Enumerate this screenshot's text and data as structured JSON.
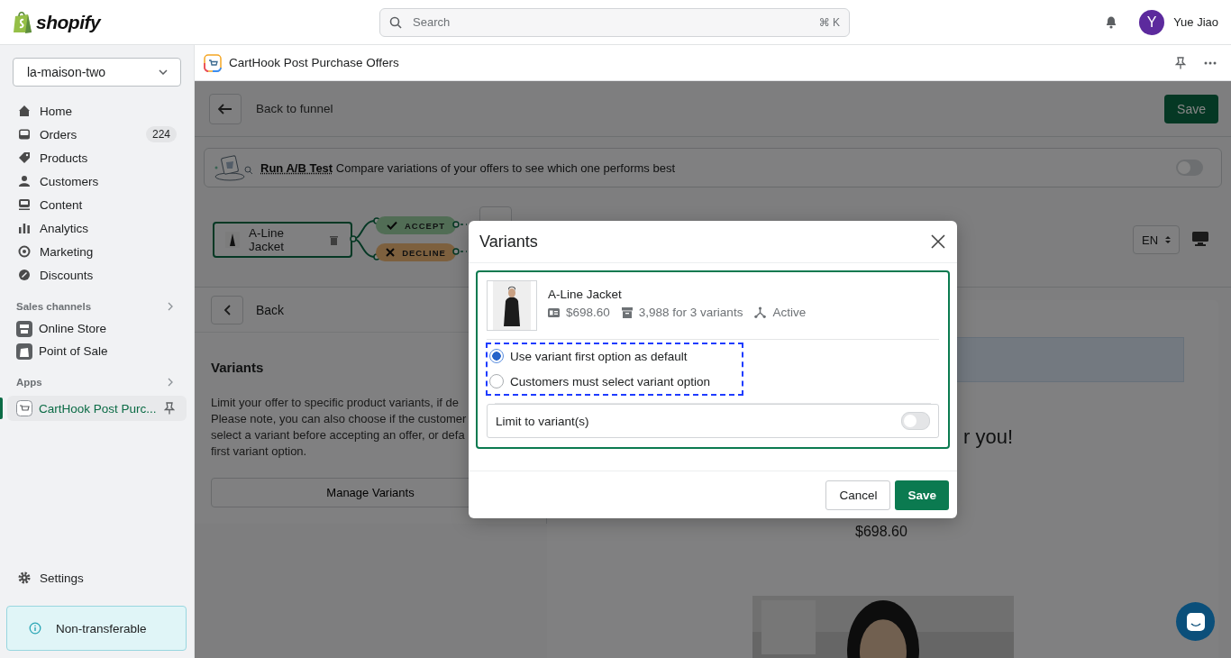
{
  "topbar": {
    "logo": "shopify",
    "search": {
      "placeholder": "Search",
      "shortcut": "⌘ K"
    },
    "user": {
      "initial": "Y",
      "name": "Yue Jiao"
    }
  },
  "sidebar": {
    "store": "la-maison-two",
    "items": [
      {
        "label": "Home"
      },
      {
        "label": "Orders",
        "badge": "224"
      },
      {
        "label": "Products"
      },
      {
        "label": "Customers"
      },
      {
        "label": "Content"
      },
      {
        "label": "Analytics"
      },
      {
        "label": "Marketing"
      },
      {
        "label": "Discounts"
      }
    ],
    "sales_channels": {
      "title": "Sales channels",
      "items": [
        {
          "label": "Online Store"
        },
        {
          "label": "Point of Sale"
        }
      ]
    },
    "apps": {
      "title": "Apps",
      "items": [
        {
          "label": "CartHook Post Purc...",
          "selected": true
        }
      ]
    },
    "settings": "Settings",
    "notice": "Non-transferable"
  },
  "app_header": {
    "title": "CartHook Post Purchase Offers"
  },
  "page": {
    "back_label": "Back to funnel",
    "save": "Save",
    "ab_test": {
      "link": "Run A/B Test",
      "text": "Compare variations of your offers to see which one performs best",
      "on": false
    },
    "funnel": {
      "node": "A-Line Jacket",
      "branches": [
        {
          "label": "ACCEPT",
          "kind": "accept"
        },
        {
          "label": "DECLINE",
          "kind": "decline"
        }
      ]
    },
    "language": "EN",
    "editor": {
      "back": "Back",
      "section_title": "Variants",
      "description": "Limit your offer to specific product variants, if de\nPlease note, you can also choose if the customer\nselect a variant before accepting an offer, or defa\nfirst variant option.",
      "button": "Manage Variants"
    },
    "preview": {
      "heading": "r you!",
      "price": "$698.60"
    }
  },
  "modal": {
    "title": "Variants",
    "product": {
      "name": "A-Line Jacket",
      "price": "$698.60",
      "inventory": "3,988 for 3 variants",
      "status": "Active"
    },
    "options": [
      {
        "label": "Use variant first option as default",
        "selected": true
      },
      {
        "label": "Customers must select variant option",
        "selected": false
      }
    ],
    "limit": {
      "label": "Limit to variant(s)",
      "on": false
    },
    "buttons": [
      {
        "label": "Cancel",
        "kind": "secondary"
      },
      {
        "label": "Save",
        "kind": "primary"
      }
    ]
  }
}
